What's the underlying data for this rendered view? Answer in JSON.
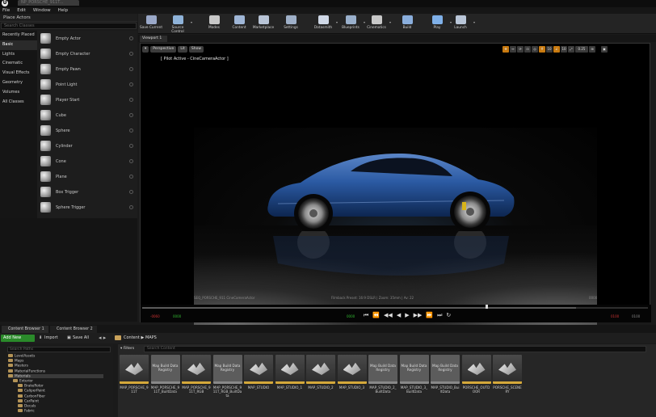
{
  "window": {
    "logo": "U",
    "doc_tab": "NP_PORSCHE_911T..."
  },
  "menu": [
    "File",
    "Edit",
    "Window",
    "Help"
  ],
  "place_actors": {
    "header": "Place Actors",
    "search_placeholder": "Search Classes",
    "categories": [
      "Recently Placed",
      "Basic",
      "Lights",
      "Cinematic",
      "Visual Effects",
      "Geometry",
      "Volumes",
      "All Classes"
    ],
    "selected_category": "Basic",
    "items": [
      "Empty Actor",
      "Empty Character",
      "Empty Pawn",
      "Point Light",
      "Player Start",
      "Cube",
      "Sphere",
      "Cylinder",
      "Cone",
      "Plane",
      "Box Trigger",
      "Sphere Trigger"
    ]
  },
  "toolbar": {
    "buttons": [
      {
        "label": "Save Current",
        "icon": "save-icon",
        "color": "#9aa8c8"
      },
      {
        "label": "Source Control",
        "icon": "source-control-icon",
        "color": "#8fb3d9"
      },
      {
        "label": "Modes",
        "icon": "modes-icon",
        "color": "#c8c8c8"
      },
      {
        "label": "Content",
        "icon": "content-icon",
        "color": "#9fb6d6"
      },
      {
        "label": "Marketplace",
        "icon": "marketplace-icon",
        "color": "#b8c4d6"
      },
      {
        "label": "Settings",
        "icon": "settings-icon",
        "color": "#9fb0c8"
      },
      {
        "label": "Datasmith",
        "icon": "datasmith-icon",
        "color": "#cfd8e6"
      },
      {
        "label": "Blueprints",
        "icon": "blueprints-icon",
        "color": "#9ab0cc"
      },
      {
        "label": "Cinematics",
        "icon": "cinematics-icon",
        "color": "#c8c8c8"
      },
      {
        "label": "Build",
        "icon": "build-icon",
        "color": "#8aaedc"
      },
      {
        "label": "Play",
        "icon": "play-icon",
        "color": "#7fb0e8"
      },
      {
        "label": "Launch",
        "icon": "launch-icon",
        "color": "#b9c6d8"
      }
    ]
  },
  "viewport": {
    "tab": "Viewport 1",
    "view_mode": "Perspective",
    "lit": "Lit",
    "show": "Show",
    "pilot": "[ Pilot Active - CineCameraActor ]",
    "zoom_value": "0.25",
    "cine_left": "SEQ_PORSCHE_911 CineCameraActor",
    "cine_mid": "Filmback Preset: 16:9 DSLR | Zoom: 35mm | Av: 22",
    "cine_right": "0000",
    "timeline": {
      "progress": 0.85,
      "t1": "-0060",
      "t2": "0000",
      "t3": "0000",
      "t4": "-0060",
      "t5": "0100",
      "t6": "0100"
    },
    "transport": [
      "⏮",
      "⏪",
      "◀◀",
      "◀",
      "▶",
      "▶▶",
      "⏩",
      "⏭",
      "↻"
    ]
  },
  "content_browser": {
    "tabs": [
      "Content Browser 1",
      "Content Browser 2"
    ],
    "add_new": "Add New",
    "import": "Import",
    "save_all": "Save All",
    "breadcrumb": [
      "Content",
      "▶",
      "MAPS"
    ],
    "search_paths_placeholder": "Search Paths",
    "filters": "Filters",
    "search_content_placeholder": "Search Content",
    "tree": [
      "LevelAssets",
      "Maps",
      "Masters",
      "MaterialFunctions",
      "Materials",
      "Exterior",
      "BrakeRotor",
      "CaliperPaint",
      "CarbonFiber",
      "CarPaint",
      "Decals",
      "Fabric"
    ],
    "assets": [
      {
        "label": "MAP_PORSCHE_911T",
        "kind": "map"
      },
      {
        "label": "MAP_PORSCHE_911T_BuiltData",
        "kind": "reg",
        "art": "Map Build Data Registry"
      },
      {
        "label": "MAP_PORSCHE_911T_RGB",
        "kind": "map"
      },
      {
        "label": "MAP_PORSCHE_911T_RGB_BuiltData",
        "kind": "reg",
        "art": "Map Build Data Registry"
      },
      {
        "label": "MAP_STUDIO",
        "kind": "map"
      },
      {
        "label": "MAP_STUDIO_1",
        "kind": "map"
      },
      {
        "label": "MAP_STUDIO_2",
        "kind": "map"
      },
      {
        "label": "MAP_STUDIO_3",
        "kind": "map"
      },
      {
        "label": "MAP_STUDIO_2_BuiltData",
        "kind": "reg",
        "art": "Map Build Data Registry"
      },
      {
        "label": "MAP_STUDIO_3_BuiltData",
        "kind": "reg",
        "art": "Map Build Data Registry"
      },
      {
        "label": "MAP_STUDIO_BuiltData",
        "kind": "reg",
        "art": "Map Build Data Registry"
      },
      {
        "label": "PORSCHE_OUTDOOR",
        "kind": "map"
      },
      {
        "label": "PORSCHE_SCENERY",
        "kind": "map"
      }
    ]
  }
}
